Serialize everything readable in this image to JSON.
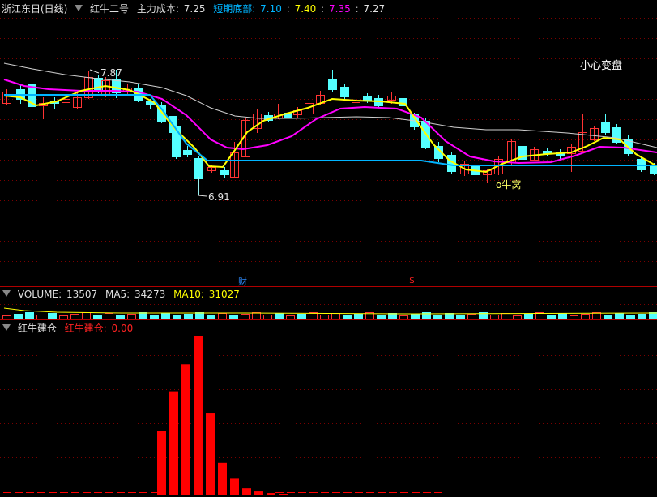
{
  "header": {
    "stock_name": "浙江东日(日线)",
    "indicator_name": "红牛二号",
    "main_cost_label": "主力成本:",
    "main_cost_value": "7.25",
    "short_bottom_label": "短期底部:",
    "short_bottom_values": [
      "7.10",
      "7.40",
      "7.35",
      "7.27"
    ]
  },
  "price_panel": {
    "annotations": {
      "high_label": "7.87",
      "low_label": "6.91",
      "warning_text": "小心变盘",
      "niuwo_text": "o牛窝",
      "finance_marker": "财",
      "dollar_marker": "$"
    }
  },
  "volume_panel": {
    "label": "VOLUME:",
    "value": "13507",
    "ma5_label": "MA5:",
    "ma5_value": "34273",
    "ma10_label": "MA10:",
    "ma10_value": "31027"
  },
  "indicator_panel": {
    "name": "红牛建仓",
    "series_label": "红牛建仓:",
    "series_value": "0.00"
  },
  "colors": {
    "up": "#ff3333",
    "down": "#54ffff",
    "ma_yellow": "#ffff00",
    "ma_magenta": "#ff00ff",
    "ma_white": "#d0d0d0",
    "support_line": "#00b4ff",
    "grid": "#7a0000",
    "bars": "#ff0000"
  },
  "indicator_bars": [
    0.4,
    0.65,
    0.82,
    1.0,
    0.51,
    0.2,
    0.1,
    0.04,
    0.02,
    0.01,
    0.005
  ]
}
